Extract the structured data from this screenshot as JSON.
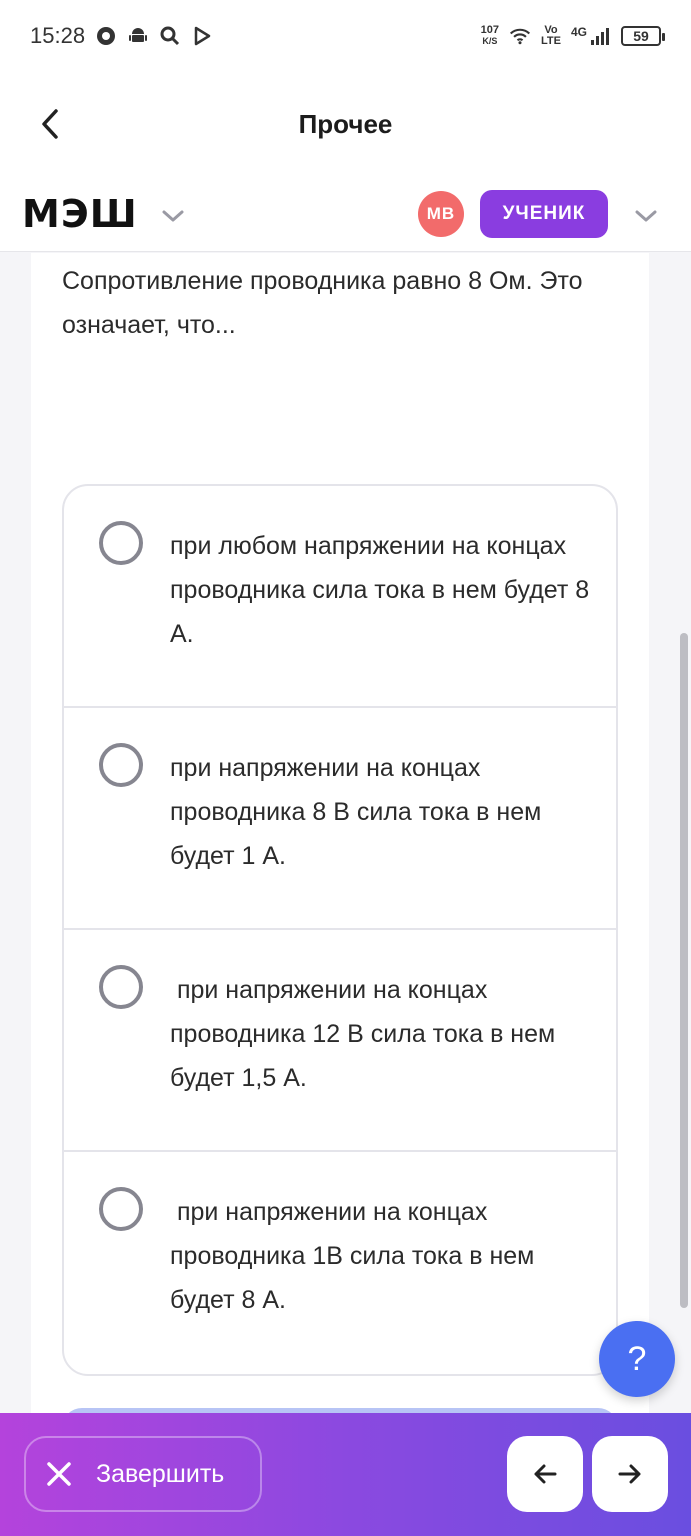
{
  "status_bar": {
    "time": "15:28",
    "speed_value": "107",
    "speed_unit": "K/S",
    "volte_top": "Vo",
    "volte_bottom": "LTE",
    "network": "4G",
    "battery": "59"
  },
  "header": {
    "title": "Прочее"
  },
  "brand": {
    "logo": "МЭШ",
    "avatar_initials": "МВ",
    "role": "УЧЕНИК"
  },
  "question": {
    "text": "Сопротивление проводника равно 8 Ом. Это означает, что..."
  },
  "options": [
    {
      "text": "при любом напряжении на концах проводника сила тока в нем будет 8 А."
    },
    {
      "text": "при напряжении на концах проводника 8 В сила тока в нем будет 1 А."
    },
    {
      "text": " при напряжении на концах проводника 12 В сила тока в нем будет 1,5 А."
    },
    {
      "text": " при напряжении на концах проводника 1В сила тока в нем будет 8 А."
    }
  ],
  "help": {
    "label": "?"
  },
  "footer": {
    "finish_label": "Завершить"
  },
  "colors": {
    "accent": "#8a3de0",
    "avatar": "#f26b6b",
    "help": "#4a6ff2"
  }
}
